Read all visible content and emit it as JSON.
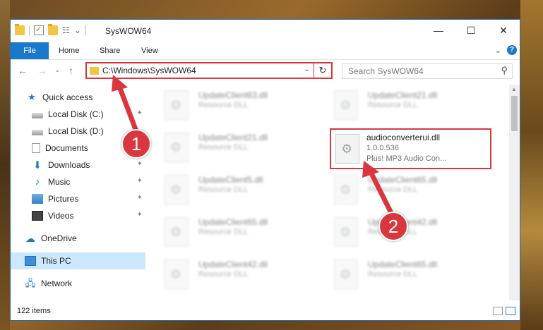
{
  "window": {
    "title": "SysWOW64",
    "minimize_glyph": "—",
    "maximize_glyph": "☐",
    "close_glyph": "✕"
  },
  "ribbon": {
    "tabs": [
      "File",
      "Home",
      "Share",
      "View"
    ],
    "expand_glyph": "⌄",
    "help_glyph": "?"
  },
  "nav": {
    "back_glyph": "←",
    "forward_glyph": "→",
    "recent_glyph": "⌄",
    "up_glyph": "↑"
  },
  "address": {
    "path": "C:\\Windows\\SysWOW64",
    "dropdown_glyph": "⌄",
    "refresh_glyph": "↻"
  },
  "search": {
    "placeholder": "Search SysWOW64",
    "icon": "search-icon"
  },
  "sidebar": {
    "items": [
      {
        "label": "Quick access",
        "icon": "star-icon",
        "pinned": false
      },
      {
        "label": "Local Disk (C:)",
        "icon": "disk-icon",
        "pinned": true
      },
      {
        "label": "Local Disk (D:)",
        "icon": "disk-icon",
        "pinned": false
      },
      {
        "label": "Documents",
        "icon": "document-icon",
        "pinned": true
      },
      {
        "label": "Downloads",
        "icon": "download-icon",
        "pinned": true
      },
      {
        "label": "Music",
        "icon": "music-icon",
        "pinned": true
      },
      {
        "label": "Pictures",
        "icon": "pictures-icon",
        "pinned": true
      },
      {
        "label": "Videos",
        "icon": "videos-icon",
        "pinned": true
      },
      {
        "label": "OneDrive",
        "icon": "cloud-icon",
        "pinned": false
      },
      {
        "label": "This PC",
        "icon": "computer-icon",
        "pinned": false
      },
      {
        "label": "Network",
        "icon": "network-icon",
        "pinned": false
      }
    ],
    "pin_glyph": "📌"
  },
  "files": {
    "left_column": [
      {
        "name": "UpdateClient63.dll",
        "type": "Resource DLL"
      },
      {
        "name": "UpdateClient21.dll",
        "type": "Resource DLL"
      },
      {
        "name": "UpdateClient5.dll",
        "type": "Resource DLL"
      },
      {
        "name": "UpdateClient65.dll",
        "type": "Resource DLL"
      },
      {
        "name": "UpdateClient42.dll",
        "type": "Resource DLL"
      }
    ],
    "right_column": [
      {
        "name": "UpdateClient21.dll",
        "type": "Resource DLL"
      },
      {
        "name": "UpdateClient65.dll",
        "type": "Resource DLL"
      },
      {
        "name": "UpdateClient42.dll",
        "type": "Resource DLL"
      },
      {
        "name": "UpdateClient65.dll",
        "type": "Resource DLL"
      }
    ],
    "highlighted": {
      "name": "audioconverterui.dll",
      "version": "1.0.0.536",
      "description": "Plus! MP3 Audio Con..."
    }
  },
  "status": {
    "item_count": "122 items"
  },
  "annotations": {
    "step1": "1",
    "step2": "2",
    "color": "#d9363e"
  },
  "colors": {
    "accent": "#1979ca",
    "selection": "#cce8ff",
    "highlight_border": "#d9363e"
  }
}
